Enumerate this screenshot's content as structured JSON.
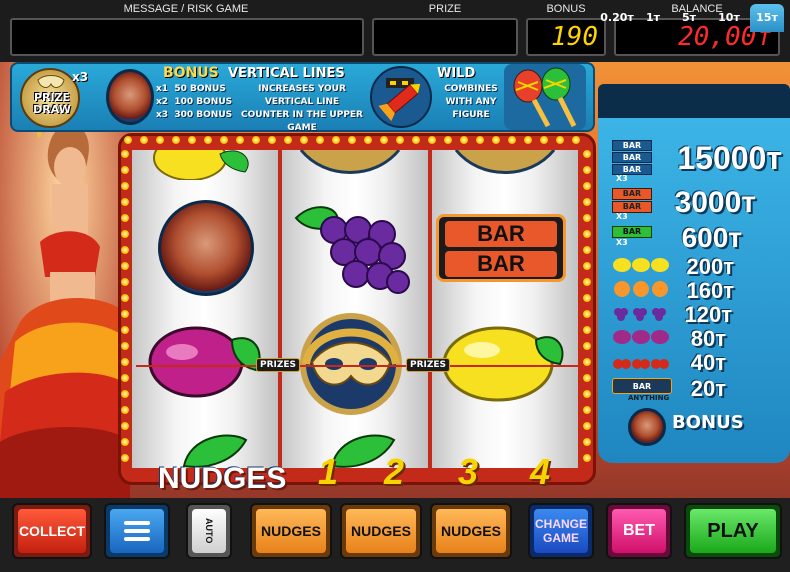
{
  "top": {
    "message_label": "MESSAGE / RISK GAME",
    "message_value": "",
    "prize_label": "PRIZE",
    "prize_value": "",
    "bonus_label": "BONUS",
    "bonus_value": "190",
    "balance_label": "BALANCE",
    "balance_value": "20,00т"
  },
  "info": {
    "prize_draw": "PRIZE DRAW",
    "prize_draw_mult": "x3",
    "bonus_title": "BONUS",
    "bonus_rows": [
      {
        "mult": "x1",
        "text": "50 BONUS"
      },
      {
        "mult": "x2",
        "text": "100 BONUS"
      },
      {
        "mult": "x3",
        "text": "300 BONUS"
      }
    ],
    "vertical_title": "VERTICAL LINES",
    "vertical_desc": "INCREASES YOUR VERTICAL LINE COUNTER IN THE UPPER GAME",
    "wild_title": "WILD",
    "wild_desc": "COMBINES WITH ANY FIGURE"
  },
  "bet_tabs": [
    {
      "label": "0.20т",
      "active": false
    },
    {
      "label": "1т",
      "active": false
    },
    {
      "label": "5т",
      "active": false
    },
    {
      "label": "10т",
      "active": false
    },
    {
      "label": "15т",
      "active": true
    }
  ],
  "paytable": [
    {
      "symbol": "bar-triple",
      "value": "15000т"
    },
    {
      "symbol": "bar-double",
      "value": "3000т"
    },
    {
      "symbol": "bar-single",
      "value": "600т"
    },
    {
      "symbol": "lemon",
      "value": "200т"
    },
    {
      "symbol": "orange",
      "value": "160т"
    },
    {
      "symbol": "grapes",
      "value": "120т"
    },
    {
      "symbol": "plum",
      "value": "80т"
    },
    {
      "symbol": "cherry",
      "value": "40т"
    },
    {
      "symbol": "any-bar",
      "value": "20т"
    }
  ],
  "paytable_labels": {
    "x3": "X3",
    "bar": "BAR",
    "anything": "ANYTHING",
    "bonus": "BONUS"
  },
  "reels": {
    "bar_text": "BAR",
    "prizes_label": "PRIZES"
  },
  "nudges": {
    "label": "NUDGES",
    "numbers": [
      "1",
      "2",
      "3",
      "4"
    ]
  },
  "buttons": {
    "collect": "COLLECT",
    "auto": "AUTO",
    "nudges": "NUDGES",
    "change_game": "CHANGE GAME",
    "bet": "BET",
    "play": "PLAY"
  },
  "colors": {
    "accent_red": "#e02a1a",
    "accent_blue": "#2aa9d8",
    "play_green": "#2bbf3a",
    "change_game_blue": "#1a7fe0",
    "bet_pink": "#e0208a",
    "nudges_orange": "#f19a2a",
    "digits_red": "#ff2a2a",
    "digits_yellow": "#ffd400"
  }
}
